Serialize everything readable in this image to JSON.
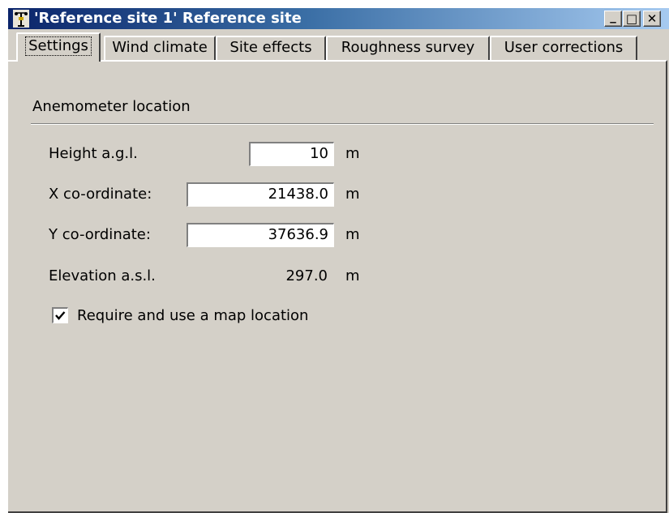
{
  "window": {
    "title": "'Reference site 1' Reference site",
    "controls": {
      "minimize": "_",
      "maximize": "□",
      "close": "✕"
    },
    "icon": "anemometer-icon"
  },
  "tabs": [
    {
      "label": "Settings",
      "active": true
    },
    {
      "label": "Wind climate",
      "active": false
    },
    {
      "label": "Site effects",
      "active": false
    },
    {
      "label": "Roughness survey",
      "active": false
    },
    {
      "label": "User corrections",
      "active": false
    }
  ],
  "anemometer": {
    "group_title": "Anemometer location",
    "height": {
      "label": "Height a.g.l.",
      "value": "10",
      "unit": "m"
    },
    "x": {
      "label": "X co-ordinate:",
      "value": "21438.0",
      "unit": "m"
    },
    "y": {
      "label": "Y co-ordinate:",
      "value": "37636.9",
      "unit": "m"
    },
    "elevation": {
      "label": "Elevation a.s.l.",
      "value": "297.0",
      "unit": "m"
    },
    "map_location": {
      "label": "Require and use a map location",
      "checked": true
    }
  },
  "colors": {
    "face": "#d4d0c8",
    "title_start": "#0a246a",
    "title_end": "#a6caf0"
  }
}
